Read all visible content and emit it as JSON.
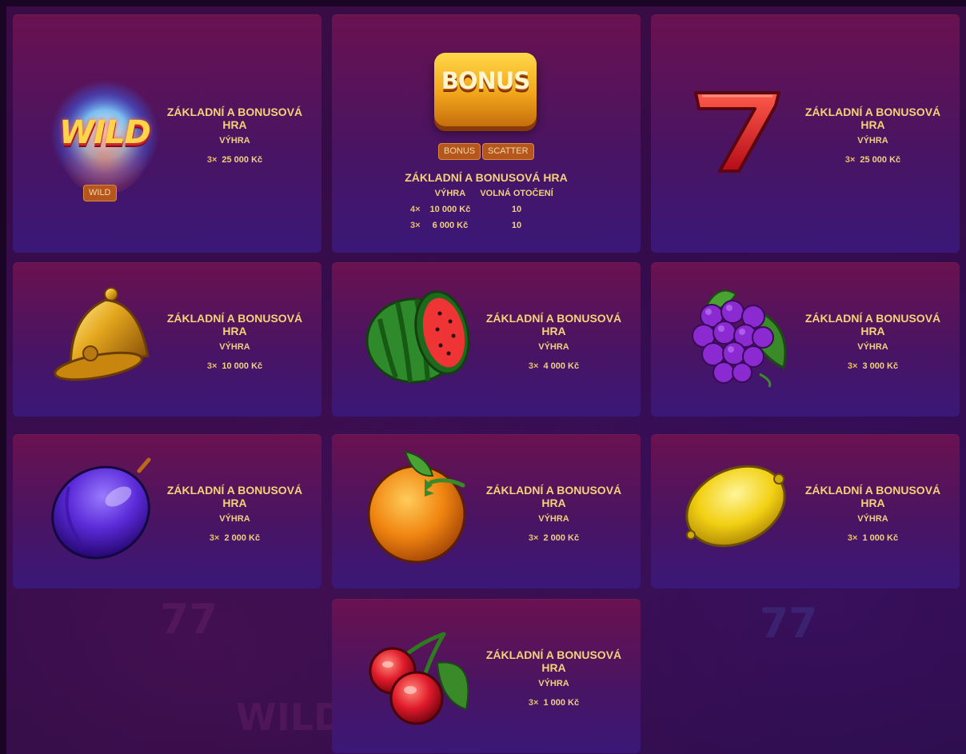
{
  "symbols": [
    {
      "id": "wild",
      "title": "ZÁKLADNÍ A BONUSOVÁ HRA",
      "win_header": "VÝHRA",
      "mult": "3×",
      "pay": "25 000 Kč",
      "tags": [
        "WILD"
      ],
      "logo": "WILD"
    },
    {
      "id": "bonus",
      "title": "ZÁKLADNÍ A BONUSOVÁ HRA",
      "win_header": "VÝHRA",
      "spins_header": "VOLNÁ OTOČENÍ",
      "logo": "BONUS",
      "tags": [
        "BONUS",
        "SCATTER"
      ],
      "rows": [
        {
          "mult": "4×",
          "pay": "10 000 Kč",
          "spins": "10"
        },
        {
          "mult": "3×",
          "pay": "6 000 Kč",
          "spins": "10"
        }
      ]
    },
    {
      "id": "seven",
      "title": "ZÁKLADNÍ A BONUSOVÁ HRA",
      "win_header": "VÝHRA",
      "mult": "3×",
      "pay": "25 000 Kč"
    },
    {
      "id": "bell",
      "title": "ZÁKLADNÍ A BONUSOVÁ HRA",
      "win_header": "VÝHRA",
      "mult": "3×",
      "pay": "10 000 Kč"
    },
    {
      "id": "watermelon",
      "title": "ZÁKLADNÍ A BONUSOVÁ HRA",
      "win_header": "VÝHRA",
      "mult": "3×",
      "pay": "4 000 Kč"
    },
    {
      "id": "grapes",
      "title": "ZÁKLADNÍ A BONUSOVÁ HRA",
      "win_header": "VÝHRA",
      "mult": "3×",
      "pay": "3 000 Kč"
    },
    {
      "id": "plum",
      "title": "ZÁKLADNÍ A BONUSOVÁ HRA",
      "win_header": "VÝHRA",
      "mult": "3×",
      "pay": "2 000 Kč"
    },
    {
      "id": "orange",
      "title": "ZÁKLADNÍ A BONUSOVÁ HRA",
      "win_header": "VÝHRA",
      "mult": "3×",
      "pay": "2 000 Kč"
    },
    {
      "id": "lemon",
      "title": "ZÁKLADNÍ A BONUSOVÁ HRA",
      "win_header": "VÝHRA",
      "mult": "3×",
      "pay": "1 000 Kč"
    },
    {
      "id": "cherry",
      "title": "ZÁKLADNÍ A BONUSOVÁ HRA",
      "win_header": "VÝHRA",
      "mult": "3×",
      "pay": "1 000 Kč"
    }
  ],
  "background": {
    "ghost_symbols": [
      "77",
      "77",
      "WILD"
    ]
  },
  "colors": {
    "card_top": "#6a1250",
    "card_bottom": "#3a1878",
    "gold_text": "#f4d27a",
    "tag_bg": "#b5561f"
  }
}
